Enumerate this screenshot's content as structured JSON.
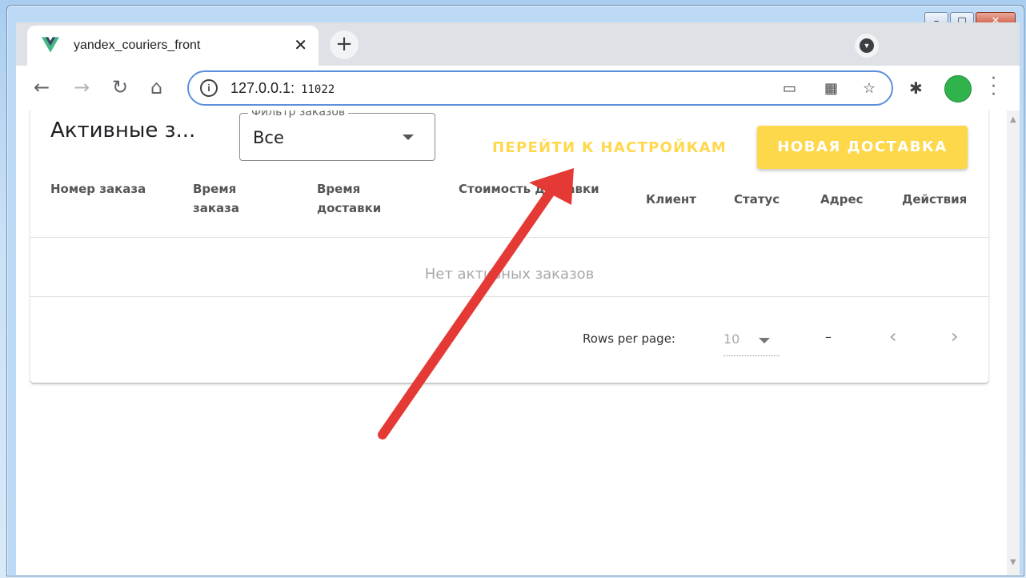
{
  "browser": {
    "tab_title": "yandex_couriers_front",
    "tab_close": "✕",
    "new_tab": "+",
    "url_host": "127.0.0.1:",
    "url_port": "11022"
  },
  "page": {
    "title": "Активные з...",
    "filter": {
      "label": "Фильтр заказов",
      "value": "Все"
    },
    "settings_button": "ПЕРЕЙТИ К НАСТРОЙКАМ",
    "new_delivery_button": "НОВАЯ ДОСТАВКА",
    "columns": [
      {
        "l1": "Номер заказа",
        "l2": ""
      },
      {
        "l1": "Время",
        "l2": "заказа"
      },
      {
        "l1": "Время",
        "l2": "доставки"
      },
      {
        "l1": "Стоимость доставки",
        "l2": ""
      },
      {
        "l1": "Клиент",
        "l2": ""
      },
      {
        "l1": "Статус",
        "l2": ""
      },
      {
        "l1": "Адрес",
        "l2": ""
      },
      {
        "l1": "Действия",
        "l2": ""
      }
    ],
    "empty_message": "Нет активных заказов",
    "footer": {
      "rows_per_page_label": "Rows per page:",
      "rows_per_page_value": "10",
      "range": "–"
    }
  },
  "colors": {
    "accent_yellow": "#fdd84a",
    "arrow_red": "#e53935",
    "omnibox_focus": "#5b8fdc"
  }
}
